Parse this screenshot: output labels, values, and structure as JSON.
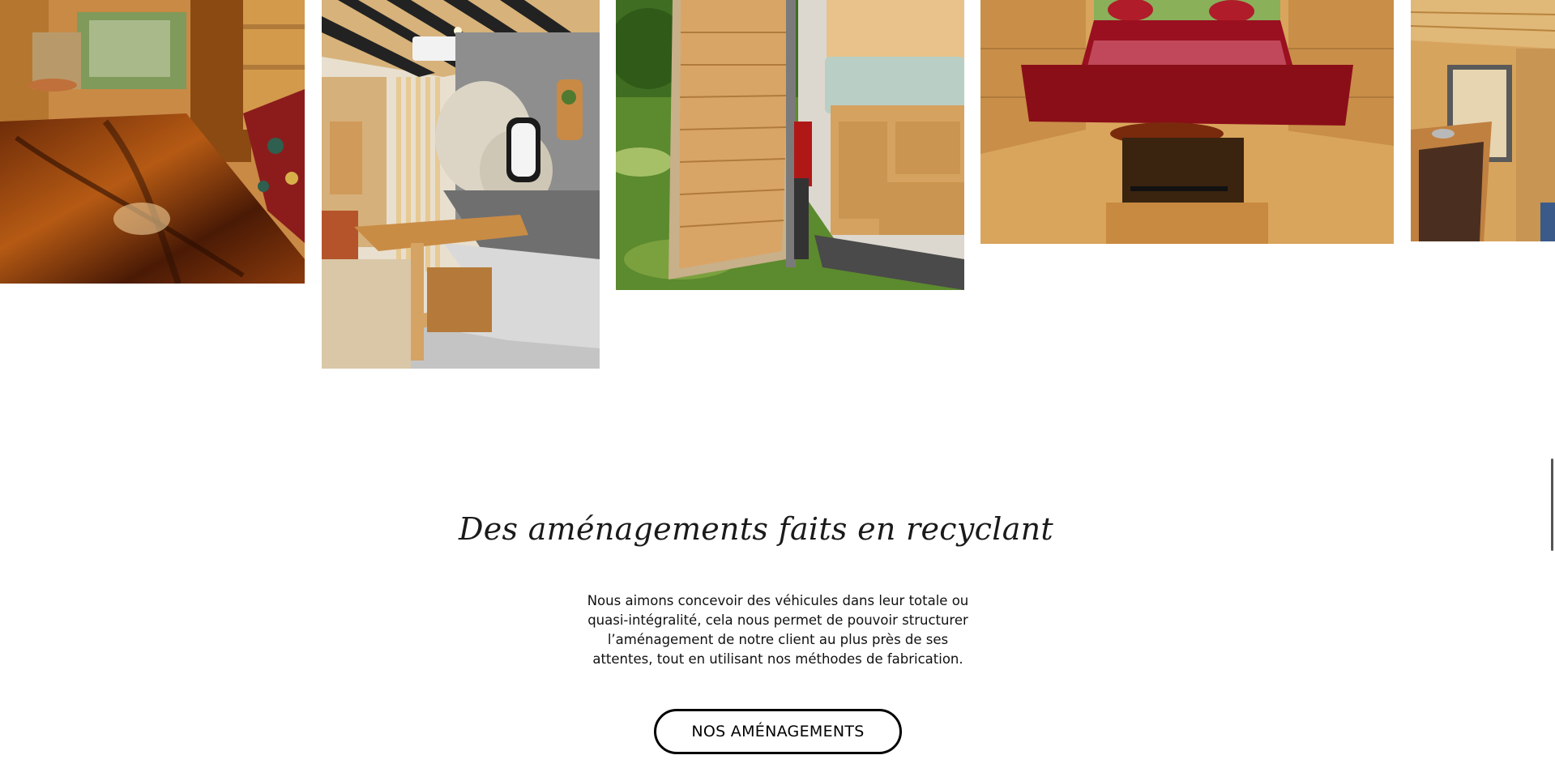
{
  "gallery": {
    "images": [
      {
        "name": "van-interior-wooden-table"
      },
      {
        "name": "van-dining-bench"
      },
      {
        "name": "van-rear-door-open"
      },
      {
        "name": "van-bed-red-blanket"
      },
      {
        "name": "van-kitchen-counter"
      }
    ]
  },
  "section": {
    "heading": "Des aménagements faits  en recyclant",
    "body": "Nous aimons concevoir des véhicules dans leur totale ou quasi-intégralité, cela nous permet de pouvoir structurer l’aménagement de notre client au plus près de ses attentes, tout en utilisant nos méthodes de fabrication.",
    "button_label": "NOS AMÉNAGEMENTS"
  },
  "colors": {
    "background": "#ffffff",
    "text": "#111111",
    "button_border": "#000000"
  }
}
